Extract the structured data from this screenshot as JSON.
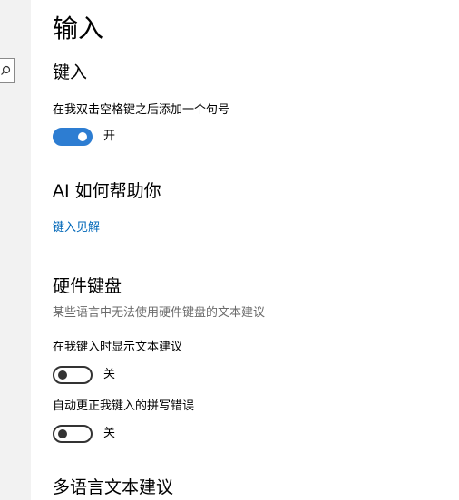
{
  "page": {
    "title": "输入"
  },
  "sections": {
    "typing": {
      "title": "键入",
      "double_space_label": "在我双击空格键之后添加一个句号",
      "double_space_state": "开",
      "double_space_on": true
    },
    "ai": {
      "title": "AI 如何帮助你",
      "insights_link": "键入见解"
    },
    "hardware_keyboard": {
      "title": "硬件键盘",
      "description": "某些语言中无法使用硬件键盘的文本建议",
      "suggestions_label": "在我键入时显示文本建议",
      "suggestions_state": "关",
      "suggestions_on": false,
      "autocorrect_label": "自动更正我键入的拼写错误",
      "autocorrect_state": "关",
      "autocorrect_on": false
    },
    "multilingual": {
      "title": "多语言文本建议"
    }
  },
  "sidebar": {
    "search_icon": "search-icon"
  },
  "colors": {
    "accent": "#2d7dd2",
    "link": "#0067b8",
    "sidebar_bg": "#f2f2f2",
    "secondary_text": "#6b6b6b"
  }
}
